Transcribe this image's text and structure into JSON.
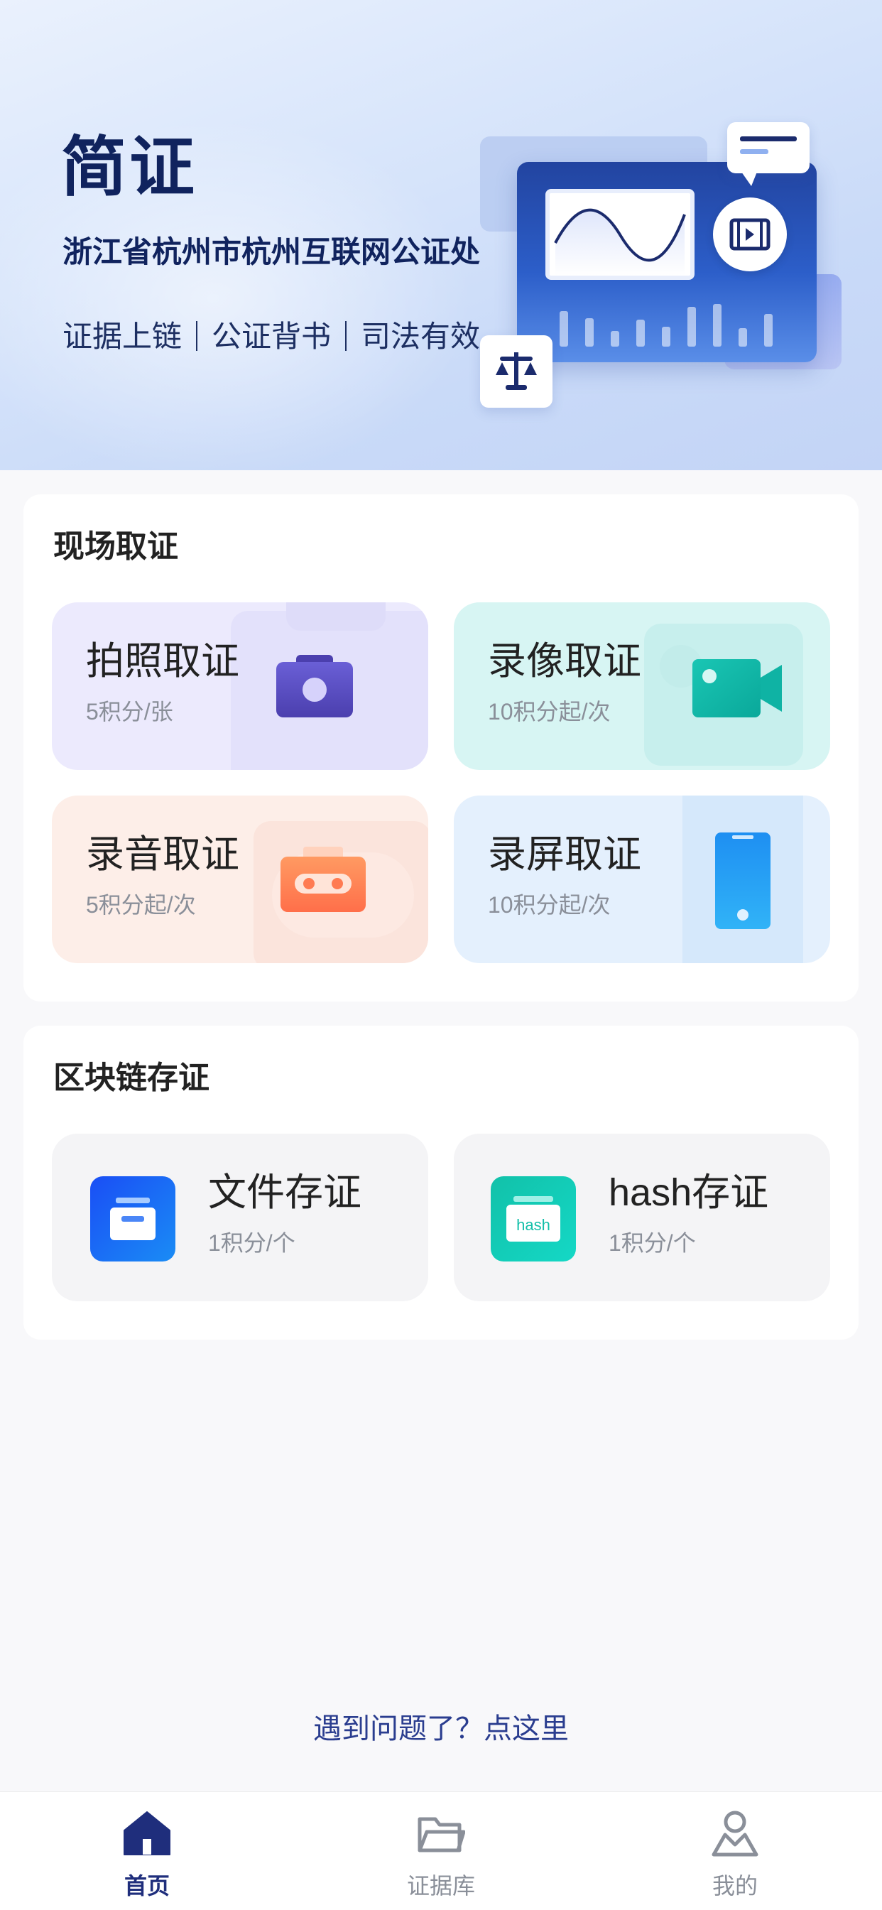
{
  "hero": {
    "title": "简证",
    "subtitle": "浙江省杭州市杭州互联网公证处",
    "tags": [
      "证据上链",
      "公证背书",
      "司法有效"
    ]
  },
  "onsite": {
    "title": "现场取证",
    "cards": [
      {
        "label": "拍照取证",
        "sub": "5积分/张",
        "icon": "camera-icon",
        "color": "#5a4fc1"
      },
      {
        "label": "录像取证",
        "sub": "10积分起/次",
        "icon": "video-camera-icon",
        "color": "#12bfb1"
      },
      {
        "label": "录音取证",
        "sub": "5积分起/次",
        "icon": "cassette-tape-icon",
        "color": "#ff7b52"
      },
      {
        "label": "录屏取证",
        "sub": "10积分起/次",
        "icon": "phone-icon",
        "color": "#1e90f0"
      }
    ]
  },
  "blockchain": {
    "title": "区块链存证",
    "cards": [
      {
        "label": "文件存证",
        "sub": "1积分/个",
        "icon": "inbox-tray-icon",
        "color": "#1a5cf5"
      },
      {
        "label": "hash存证",
        "sub": "1积分/个",
        "icon": "hash-icon",
        "icon_text": "hash",
        "color": "#12c7b8"
      }
    ]
  },
  "help_link": "遇到问题了？点这里",
  "tabs": [
    {
      "label": "首页",
      "icon": "home-icon",
      "active": true
    },
    {
      "label": "证据库",
      "icon": "folder-icon",
      "active": false
    },
    {
      "label": "我的",
      "icon": "person-icon",
      "active": false
    }
  ],
  "colors": {
    "primary": "#1f2e7c",
    "hero_text": "#10235e",
    "inactive": "#8a8f99"
  }
}
